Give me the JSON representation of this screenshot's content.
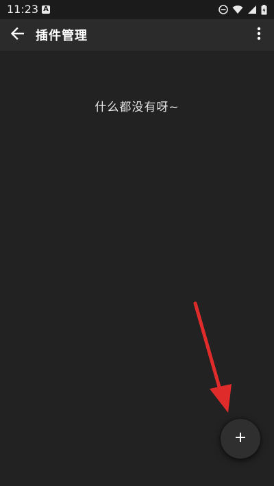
{
  "status_bar": {
    "time": "11:23",
    "notification_icon": "a-notification-icon",
    "icons": [
      "do-not-disturb-icon",
      "wifi-icon",
      "cellular-signal-icon",
      "battery-charging-icon"
    ]
  },
  "app_bar": {
    "back_icon": "arrow-back-icon",
    "title": "插件管理",
    "menu_icon": "more-vert-icon"
  },
  "content": {
    "empty_message": "什么都没有呀~"
  },
  "fab": {
    "icon": "plus-icon"
  },
  "annotation": {
    "arrow_color": "#e02b2b"
  },
  "colors": {
    "background": "#222222",
    "app_bar": "#2b2b2b",
    "status_bar": "#1b1b1b",
    "fab": "#2f2f2f"
  }
}
